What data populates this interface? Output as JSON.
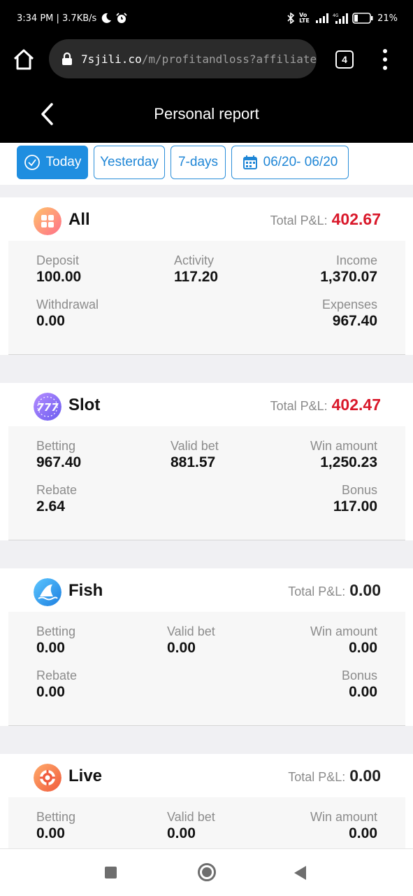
{
  "status_bar": {
    "time_speed": "3:34 PM | 3.7KB/s",
    "icons": [
      "moon-icon",
      "alarm-icon",
      "bluetooth-icon",
      "volte-icon",
      "signal-icon",
      "signal-4g-icon",
      "battery-icon"
    ],
    "volte": "Vo LTE",
    "battery": "21%"
  },
  "browser": {
    "url_domain": "7sjili.co",
    "url_path": "/m/profitandloss?affiliateCode",
    "tab_count": "4"
  },
  "header": {
    "title": "Personal report"
  },
  "filters": {
    "today": "Today",
    "yesterday": "Yesterday",
    "seven_days": "7-days",
    "date_range": "06/20- 06/20",
    "active": "today",
    "accent": "#1f8ee0"
  },
  "cards": [
    {
      "name": "All",
      "icon": "grid-icon",
      "pl_label": "Total P&L:",
      "pl_value": "402.67",
      "pl_color": "#d9182a",
      "stats": [
        {
          "label": "Deposit",
          "value": "100.00"
        },
        {
          "label": "Activity",
          "value": "117.20"
        },
        {
          "label": "Income",
          "value": "1,370.07"
        },
        {
          "label": "Withdrawal",
          "value": "0.00"
        },
        {
          "label": "Expenses",
          "value": "967.40"
        }
      ]
    },
    {
      "name": "Slot",
      "icon": "slot-777-icon",
      "pl_label": "Total P&L:",
      "pl_value": "402.47",
      "pl_color": "#d9182a",
      "stats": [
        {
          "label": "Betting",
          "value": "967.40"
        },
        {
          "label": "Valid bet",
          "value": "881.57"
        },
        {
          "label": "Win amount",
          "value": "1,250.23"
        },
        {
          "label": "Rebate",
          "value": "2.64"
        },
        {
          "label": "Bonus",
          "value": "117.00"
        }
      ]
    },
    {
      "name": "Fish",
      "icon": "shark-fin-icon",
      "pl_label": "Total P&L:",
      "pl_value": "0.00",
      "pl_color": "#222222",
      "stats": [
        {
          "label": "Betting",
          "value": "0.00"
        },
        {
          "label": "Valid bet",
          "value": "0.00"
        },
        {
          "label": "Win amount",
          "value": "0.00"
        },
        {
          "label": "Rebate",
          "value": "0.00"
        },
        {
          "label": "Bonus",
          "value": "0.00"
        }
      ]
    },
    {
      "name": "Live",
      "icon": "poker-chip-icon",
      "pl_label": "Total P&L:",
      "pl_value": "0.00",
      "pl_color": "#222222",
      "stats": [
        {
          "label": "Betting",
          "value": "0.00"
        },
        {
          "label": "Valid bet",
          "value": "0.00"
        },
        {
          "label": "Win amount",
          "value": "0.00"
        }
      ]
    }
  ]
}
